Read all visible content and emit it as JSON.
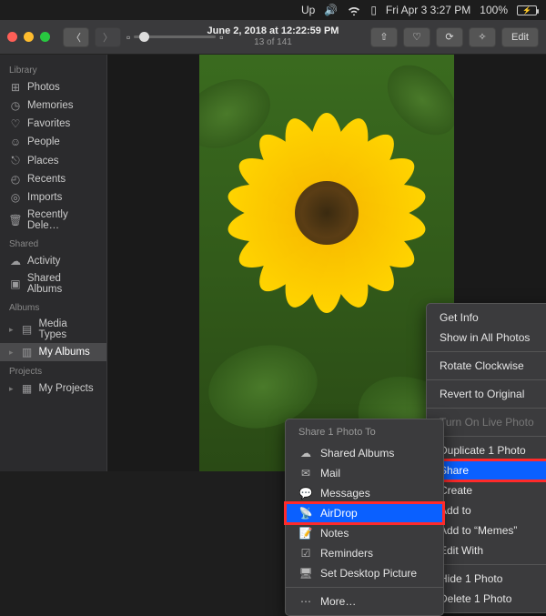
{
  "menubar": {
    "up_icon": "Up",
    "datetime": "Fri Apr 3  3:27 PM",
    "battery_pct": "100%",
    "battery_icon": "⚡"
  },
  "toolbar": {
    "title": "June 2, 2018 at 12:22:59 PM",
    "subtitle": "13 of 141",
    "edit_label": "Edit"
  },
  "sidebar": {
    "sections": [
      {
        "label": "Library",
        "items": [
          {
            "icon": "⊞",
            "label": "Photos"
          },
          {
            "icon": "◷",
            "label": "Memories"
          },
          {
            "icon": "♡",
            "label": "Favorites"
          },
          {
            "icon": "☺",
            "label": "People"
          },
          {
            "icon": "⎋",
            "label": "Places"
          },
          {
            "icon": "◴",
            "label": "Recents"
          },
          {
            "icon": "◎",
            "label": "Imports"
          },
          {
            "icon": "🗑",
            "label": "Recently Dele…"
          }
        ]
      },
      {
        "label": "Shared",
        "items": [
          {
            "icon": "☁",
            "label": "Activity"
          },
          {
            "icon": "▣",
            "label": "Shared Albums"
          }
        ]
      },
      {
        "label": "Albums",
        "items": [
          {
            "icon": "▤",
            "label": "Media Types",
            "chev": true
          },
          {
            "icon": "▥",
            "label": "My Albums",
            "chev": true,
            "selected": true
          }
        ]
      },
      {
        "label": "Projects",
        "items": [
          {
            "icon": "▦",
            "label": "My Projects",
            "chev": true
          }
        ]
      }
    ]
  },
  "context_menu": {
    "items": [
      {
        "label": "Get Info"
      },
      {
        "label": "Show in All Photos"
      },
      {
        "sep": true
      },
      {
        "label": "Rotate Clockwise"
      },
      {
        "sep": true
      },
      {
        "label": "Revert to Original"
      },
      {
        "sep": true
      },
      {
        "label": "Turn On Live Photo",
        "disabled": true
      },
      {
        "sep": true
      },
      {
        "label": "Duplicate 1 Photo"
      },
      {
        "label": "Share",
        "sub": true,
        "selected": true,
        "highlight": true
      },
      {
        "label": "Create",
        "sub": true
      },
      {
        "label": "Add to",
        "sub": true
      },
      {
        "label": "Add to “Memes”"
      },
      {
        "label": "Edit With",
        "sub": true
      },
      {
        "sep": true
      },
      {
        "label": "Hide 1 Photo"
      },
      {
        "label": "Delete 1 Photo"
      }
    ]
  },
  "share_menu": {
    "header": "Share 1 Photo To",
    "items": [
      {
        "icon": "☁",
        "label": "Shared Albums"
      },
      {
        "icon": "✉",
        "label": "Mail"
      },
      {
        "icon": "💬",
        "label": "Messages"
      },
      {
        "icon": "📡",
        "label": "AirDrop",
        "selected": true,
        "highlight": true
      },
      {
        "icon": "📝",
        "label": "Notes"
      },
      {
        "icon": "☑",
        "label": "Reminders"
      },
      {
        "icon": "🖥",
        "label": "Set Desktop Picture"
      },
      {
        "sep": true
      },
      {
        "icon": "⋯",
        "label": "More…"
      }
    ]
  }
}
